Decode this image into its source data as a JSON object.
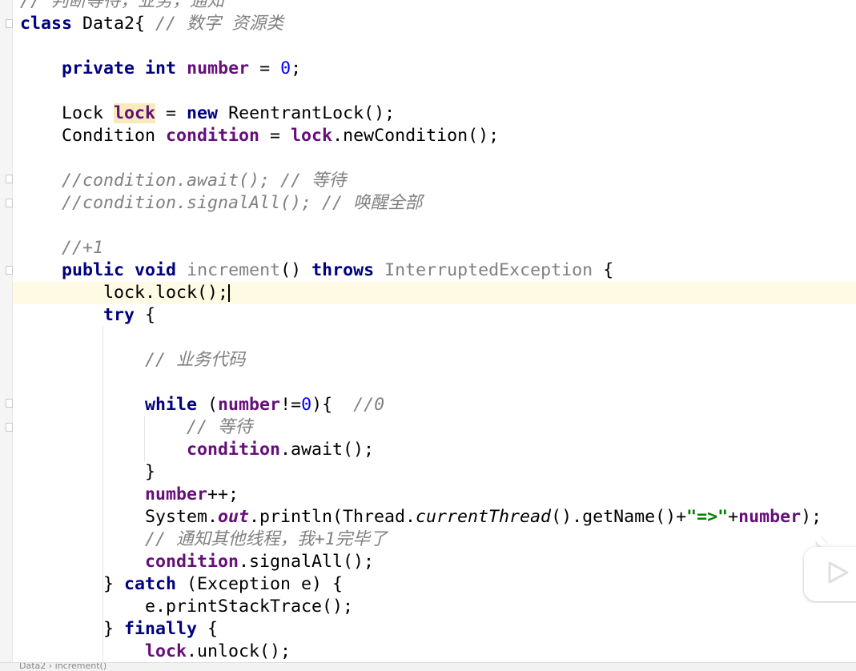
{
  "editor": {
    "lines": [
      [
        [
          "// 判断等待，业务，通知",
          "cm"
        ]
      ],
      [
        [
          "class",
          "kw"
        ],
        [
          " Data2{ ",
          ""
        ],
        [
          "// 数字 资源类",
          "cm"
        ]
      ],
      [],
      [
        [
          "    ",
          ""
        ],
        [
          "private",
          "kw"
        ],
        [
          " ",
          ""
        ],
        [
          "int",
          "kw"
        ],
        [
          " ",
          ""
        ],
        [
          "number",
          "fld"
        ],
        [
          " = ",
          ""
        ],
        [
          "0",
          "num"
        ],
        [
          ";",
          ""
        ]
      ],
      [],
      [
        [
          "    Lock ",
          ""
        ],
        [
          "lock",
          "fld hl"
        ],
        [
          " = ",
          ""
        ],
        [
          "new",
          "kw"
        ],
        [
          " ReentrantLock();",
          ""
        ]
      ],
      [
        [
          "    Condition ",
          ""
        ],
        [
          "condition",
          "fld"
        ],
        [
          " = ",
          ""
        ],
        [
          "lock",
          "fld"
        ],
        [
          ".newCondition();",
          ""
        ]
      ],
      [],
      [
        [
          "    ",
          ""
        ],
        [
          "//condition.await(); // 等待",
          "cm"
        ]
      ],
      [
        [
          "    ",
          ""
        ],
        [
          "//condition.signalAll(); // 唤醒全部",
          "cm"
        ]
      ],
      [],
      [
        [
          "    ",
          ""
        ],
        [
          "//+1",
          "cm"
        ]
      ],
      [
        [
          "    ",
          ""
        ],
        [
          "public",
          "kw"
        ],
        [
          " ",
          ""
        ],
        [
          "void",
          "kw"
        ],
        [
          " ",
          ""
        ],
        [
          "increment",
          "unused"
        ],
        [
          "() ",
          ""
        ],
        [
          "throws",
          "kw"
        ],
        [
          " ",
          ""
        ],
        [
          "InterruptedException",
          "unused"
        ],
        [
          " {",
          ""
        ]
      ],
      [
        [
          "        lock.lock();",
          ""
        ]
      ],
      [
        [
          "        ",
          ""
        ],
        [
          "try",
          "kw"
        ],
        [
          " {",
          ""
        ]
      ],
      [],
      [
        [
          "            ",
          ""
        ],
        [
          "// 业务代码",
          "cm"
        ]
      ],
      [],
      [
        [
          "            ",
          ""
        ],
        [
          "while",
          "kw"
        ],
        [
          " (",
          ""
        ],
        [
          "number",
          "fld"
        ],
        [
          "!=",
          ""
        ],
        [
          "0",
          "num"
        ],
        [
          "){  ",
          ""
        ],
        [
          "//0",
          "cm"
        ]
      ],
      [
        [
          "                ",
          ""
        ],
        [
          "// 等待",
          "cm"
        ]
      ],
      [
        [
          "                ",
          ""
        ],
        [
          "condition",
          "fld"
        ],
        [
          ".await();",
          ""
        ]
      ],
      [
        [
          "            }",
          ""
        ]
      ],
      [
        [
          "            ",
          ""
        ],
        [
          "number",
          "fld"
        ],
        [
          "++;",
          ""
        ]
      ],
      [
        [
          "            System.",
          ""
        ],
        [
          "out",
          "sfld"
        ],
        [
          ".println(Thread.",
          ""
        ],
        [
          "currentThread",
          "it"
        ],
        [
          "().getName()+",
          ""
        ],
        [
          "\"=>\"",
          "str"
        ],
        [
          "+",
          ""
        ],
        [
          "number",
          "fld"
        ],
        [
          ");",
          ""
        ]
      ],
      [
        [
          "            ",
          ""
        ],
        [
          "// 通知其他线程，我+1完毕了",
          "cm"
        ]
      ],
      [
        [
          "            ",
          ""
        ],
        [
          "condition",
          "fld"
        ],
        [
          ".signalAll();",
          ""
        ]
      ],
      [
        [
          "        } ",
          ""
        ],
        [
          "catch",
          "kw"
        ],
        [
          " (Exception e) {",
          ""
        ]
      ],
      [
        [
          "            e.printStackTrace();",
          ""
        ]
      ],
      [
        [
          "        } ",
          ""
        ],
        [
          "finally",
          "kw"
        ],
        [
          " {",
          ""
        ]
      ],
      [
        [
          "            ",
          ""
        ],
        [
          "lock",
          "fld"
        ],
        [
          ".unlock();",
          ""
        ]
      ]
    ],
    "caret_line": 13
  },
  "status": {
    "breadcrumb": "Data2 › increment()"
  },
  "overlay": {
    "icon": "tv-play-icon"
  }
}
